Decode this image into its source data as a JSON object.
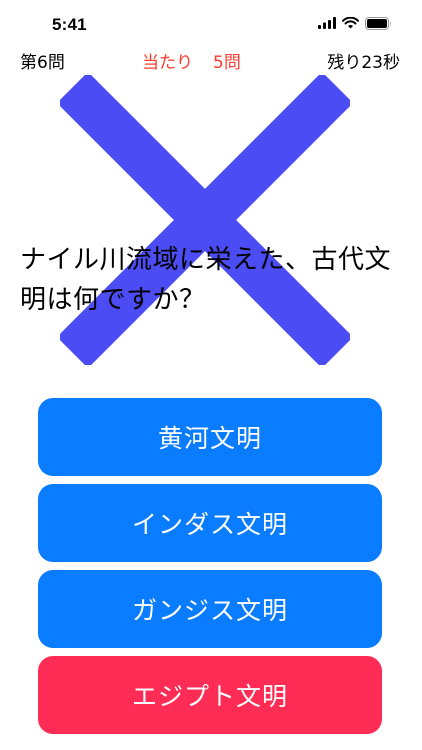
{
  "status_bar": {
    "time": "5:41",
    "icons": [
      "signal-icon",
      "wifi-icon",
      "battery-icon"
    ]
  },
  "header": {
    "question_number": "第6問",
    "hits_label": "当たり",
    "hits_count": "5問",
    "remaining": "残り23秒"
  },
  "feedback": {
    "mark": "cross-mark-icon",
    "color": "#4c4cf5"
  },
  "question": {
    "text": "ナイル川流域に栄えた、古代文明は何ですか？"
  },
  "answers": [
    {
      "label": "黄河文明",
      "color": "#0a7cff"
    },
    {
      "label": "インダス文明",
      "color": "#0a7cff"
    },
    {
      "label": "ガンジス文明",
      "color": "#0a7cff"
    },
    {
      "label": "エジプト文明",
      "color": "#ff2d55"
    }
  ]
}
